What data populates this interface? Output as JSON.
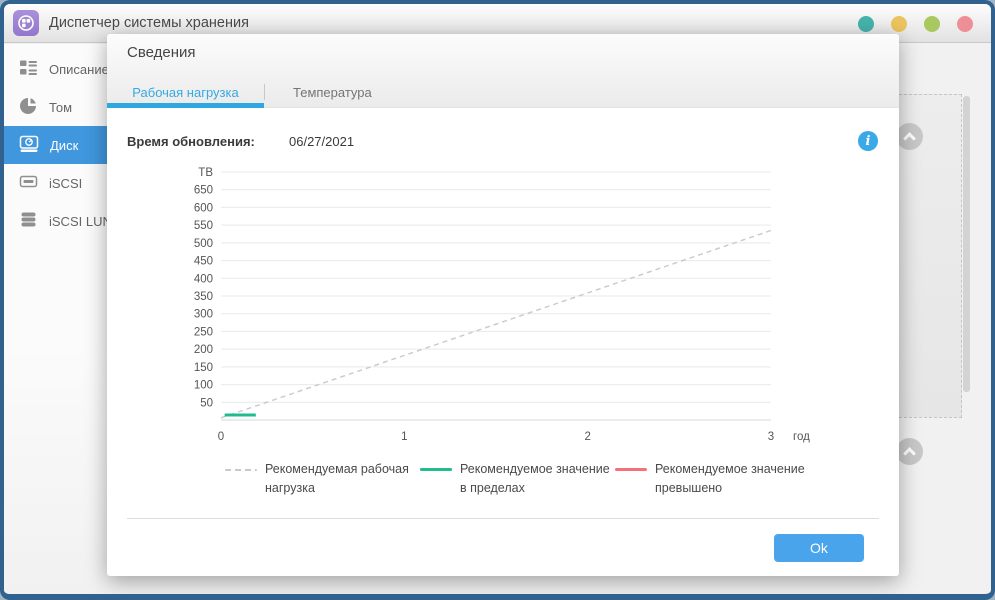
{
  "window": {
    "title": "Диспетчер системы хранения"
  },
  "sidebar": {
    "items": [
      {
        "label": "Описание",
        "selected": false
      },
      {
        "label": "Том",
        "selected": false
      },
      {
        "label": "Диск",
        "selected": true
      },
      {
        "label": "iSCSI",
        "selected": false
      },
      {
        "label": "iSCSI LUN",
        "selected": false
      }
    ]
  },
  "modal": {
    "title": "Сведения",
    "tabs": [
      {
        "label": "Рабочая нагрузка",
        "active": true
      },
      {
        "label": "Температура",
        "active": false
      }
    ],
    "update_time_label": "Время обновления:",
    "update_time_value": "06/27/2021",
    "info_icon_glyph": "i",
    "ok_label": "Ok"
  },
  "chart_data": {
    "type": "line",
    "title": "",
    "x_axis_label": "год",
    "xlim": [
      0,
      3
    ],
    "ylim": [
      0,
      700
    ],
    "grid": true,
    "legend_position": "bottom",
    "x_ticks": {
      "values": [
        0,
        1,
        2,
        3
      ],
      "labels": [
        "0",
        "1",
        "2",
        "3"
      ]
    },
    "y_ticks": {
      "values": [
        700,
        650,
        600,
        550,
        500,
        450,
        400,
        350,
        300,
        250,
        200,
        150,
        100,
        50
      ],
      "labels": [
        "TB",
        "650",
        "600",
        "550",
        "500",
        "450",
        "400",
        "350",
        "300",
        "250",
        "200",
        "150",
        "100",
        "50"
      ]
    },
    "series": [
      {
        "name": "Рекомендуемая рабочая нагрузка",
        "style": "dashed",
        "color": "#cccccc",
        "points": [
          [
            0,
            6
          ],
          [
            3,
            535
          ]
        ]
      },
      {
        "name": "Рекомендуемое значение в пределах",
        "style": "solid",
        "color": "#1fbd8d",
        "points": [
          [
            0.02,
            14
          ],
          [
            0.19,
            14
          ]
        ]
      },
      {
        "name": "Рекомендуемое значение превышено",
        "style": "solid",
        "color": "#f4717c",
        "points": []
      }
    ]
  },
  "colors": {
    "window_border": "#31628f",
    "accent_blue": "#36a9e1",
    "selected_sidebar_item": "#4097de",
    "ok_button": "#4aa4eb",
    "info_icon": "#3aa9e8",
    "gridline": "#e9e9e9",
    "dashed_line": "#cccccc",
    "green_line": "#1fbd8d",
    "red_line": "#f4717c",
    "dot_teal": "#45b4ac",
    "dot_yellow": "#ecc45f",
    "dot_green": "#a9c860",
    "dot_red": "#ee8f97"
  }
}
